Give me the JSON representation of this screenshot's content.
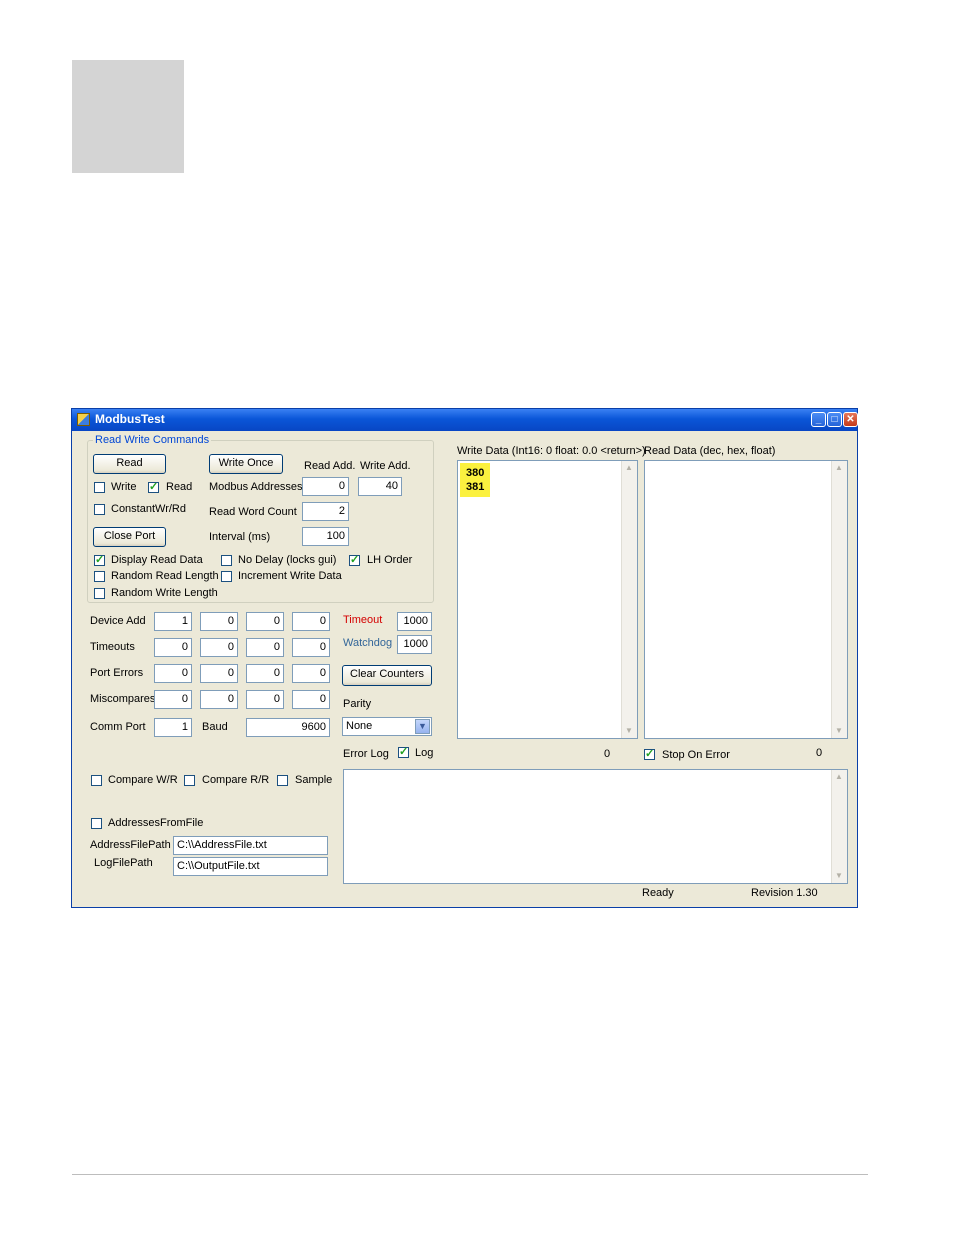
{
  "window": {
    "title": "ModbusTest"
  },
  "group": {
    "title": "Read Write Commands",
    "read_button": "Read",
    "write_once_button": "Write Once",
    "read_add_header": "Read Add.",
    "write_add_header": "Write Add.",
    "modbus_addresses_label": "Modbus Addresses",
    "read_add_value": "0",
    "write_add_value": "40",
    "read_word_count_label": "Read Word Count",
    "read_word_count_value": "2",
    "close_port_button": "Close Port",
    "interval_label": "Interval (ms)",
    "interval_value": "100",
    "write_cb": {
      "label": "Write",
      "checked": false
    },
    "read_cb": {
      "label": "Read",
      "checked": true
    },
    "constant_cb": {
      "label": "ConstantWr/Rd",
      "checked": false
    },
    "display_read_cb": {
      "label": "Display Read Data",
      "checked": true
    },
    "no_delay_cb": {
      "label": "No Delay (locks gui)",
      "checked": false
    },
    "lh_order_cb": {
      "label": "LH Order",
      "checked": true
    },
    "random_read_cb": {
      "label": "Random Read Length",
      "checked": false
    },
    "increment_write_cb": {
      "label": "Increment Write Data",
      "checked": false
    },
    "random_write_cb": {
      "label": "Random Write Length",
      "checked": false
    }
  },
  "grid": {
    "device_add": {
      "label": "Device Add",
      "values": [
        "1",
        "0",
        "0",
        "0"
      ]
    },
    "timeouts": {
      "label": "Timeouts",
      "values": [
        "0",
        "0",
        "0",
        "0"
      ]
    },
    "port_errors": {
      "label": "Port Errors",
      "values": [
        "0",
        "0",
        "0",
        "0"
      ]
    },
    "miscompares": {
      "label": "Miscompares",
      "values": [
        "0",
        "0",
        "0",
        "0"
      ]
    }
  },
  "timeout": {
    "label": "Timeout",
    "value": "1000",
    "color": "#d40000"
  },
  "watchdog": {
    "label": "Watchdog",
    "value": "1000",
    "color": "#336699"
  },
  "clear_counters_button": "Clear Counters",
  "parity": {
    "label": "Parity",
    "selected": "None"
  },
  "comm": {
    "port_label": "Comm Port",
    "port_value": "1",
    "baud_label": "Baud",
    "baud_value": "9600"
  },
  "write_data": {
    "label": "Write Data (Int16: 0 float: 0.0 <return>)",
    "lines": [
      "380",
      "381"
    ],
    "highlight_color": "#fbf13f"
  },
  "read_data": {
    "label": "Read Data (dec, hex, float)"
  },
  "error_log": {
    "label": "Error Log",
    "log_cb": {
      "label": "Log",
      "checked": true
    },
    "count": "0"
  },
  "stop_on_error": {
    "label": "Stop On Error",
    "checked": true,
    "count": "0"
  },
  "compare": {
    "compare_wr": {
      "label": "Compare W/R",
      "checked": false
    },
    "compare_rr": {
      "label": "Compare R/R",
      "checked": false
    },
    "sample": {
      "label": "Sample",
      "checked": false
    }
  },
  "files": {
    "addresses_from_file": {
      "label": "AddressesFromFile",
      "checked": false
    },
    "address_path_label": "AddressFilePath",
    "address_path_value": "C:\\\\AddressFile.txt",
    "log_path_label": "LogFilePath",
    "log_path_value": "C:\\\\OutputFile.txt"
  },
  "status": {
    "state": "Ready",
    "revision": "Revision 1.30"
  },
  "icons": {
    "check": "✓",
    "combo": "chevron-down-icon"
  }
}
